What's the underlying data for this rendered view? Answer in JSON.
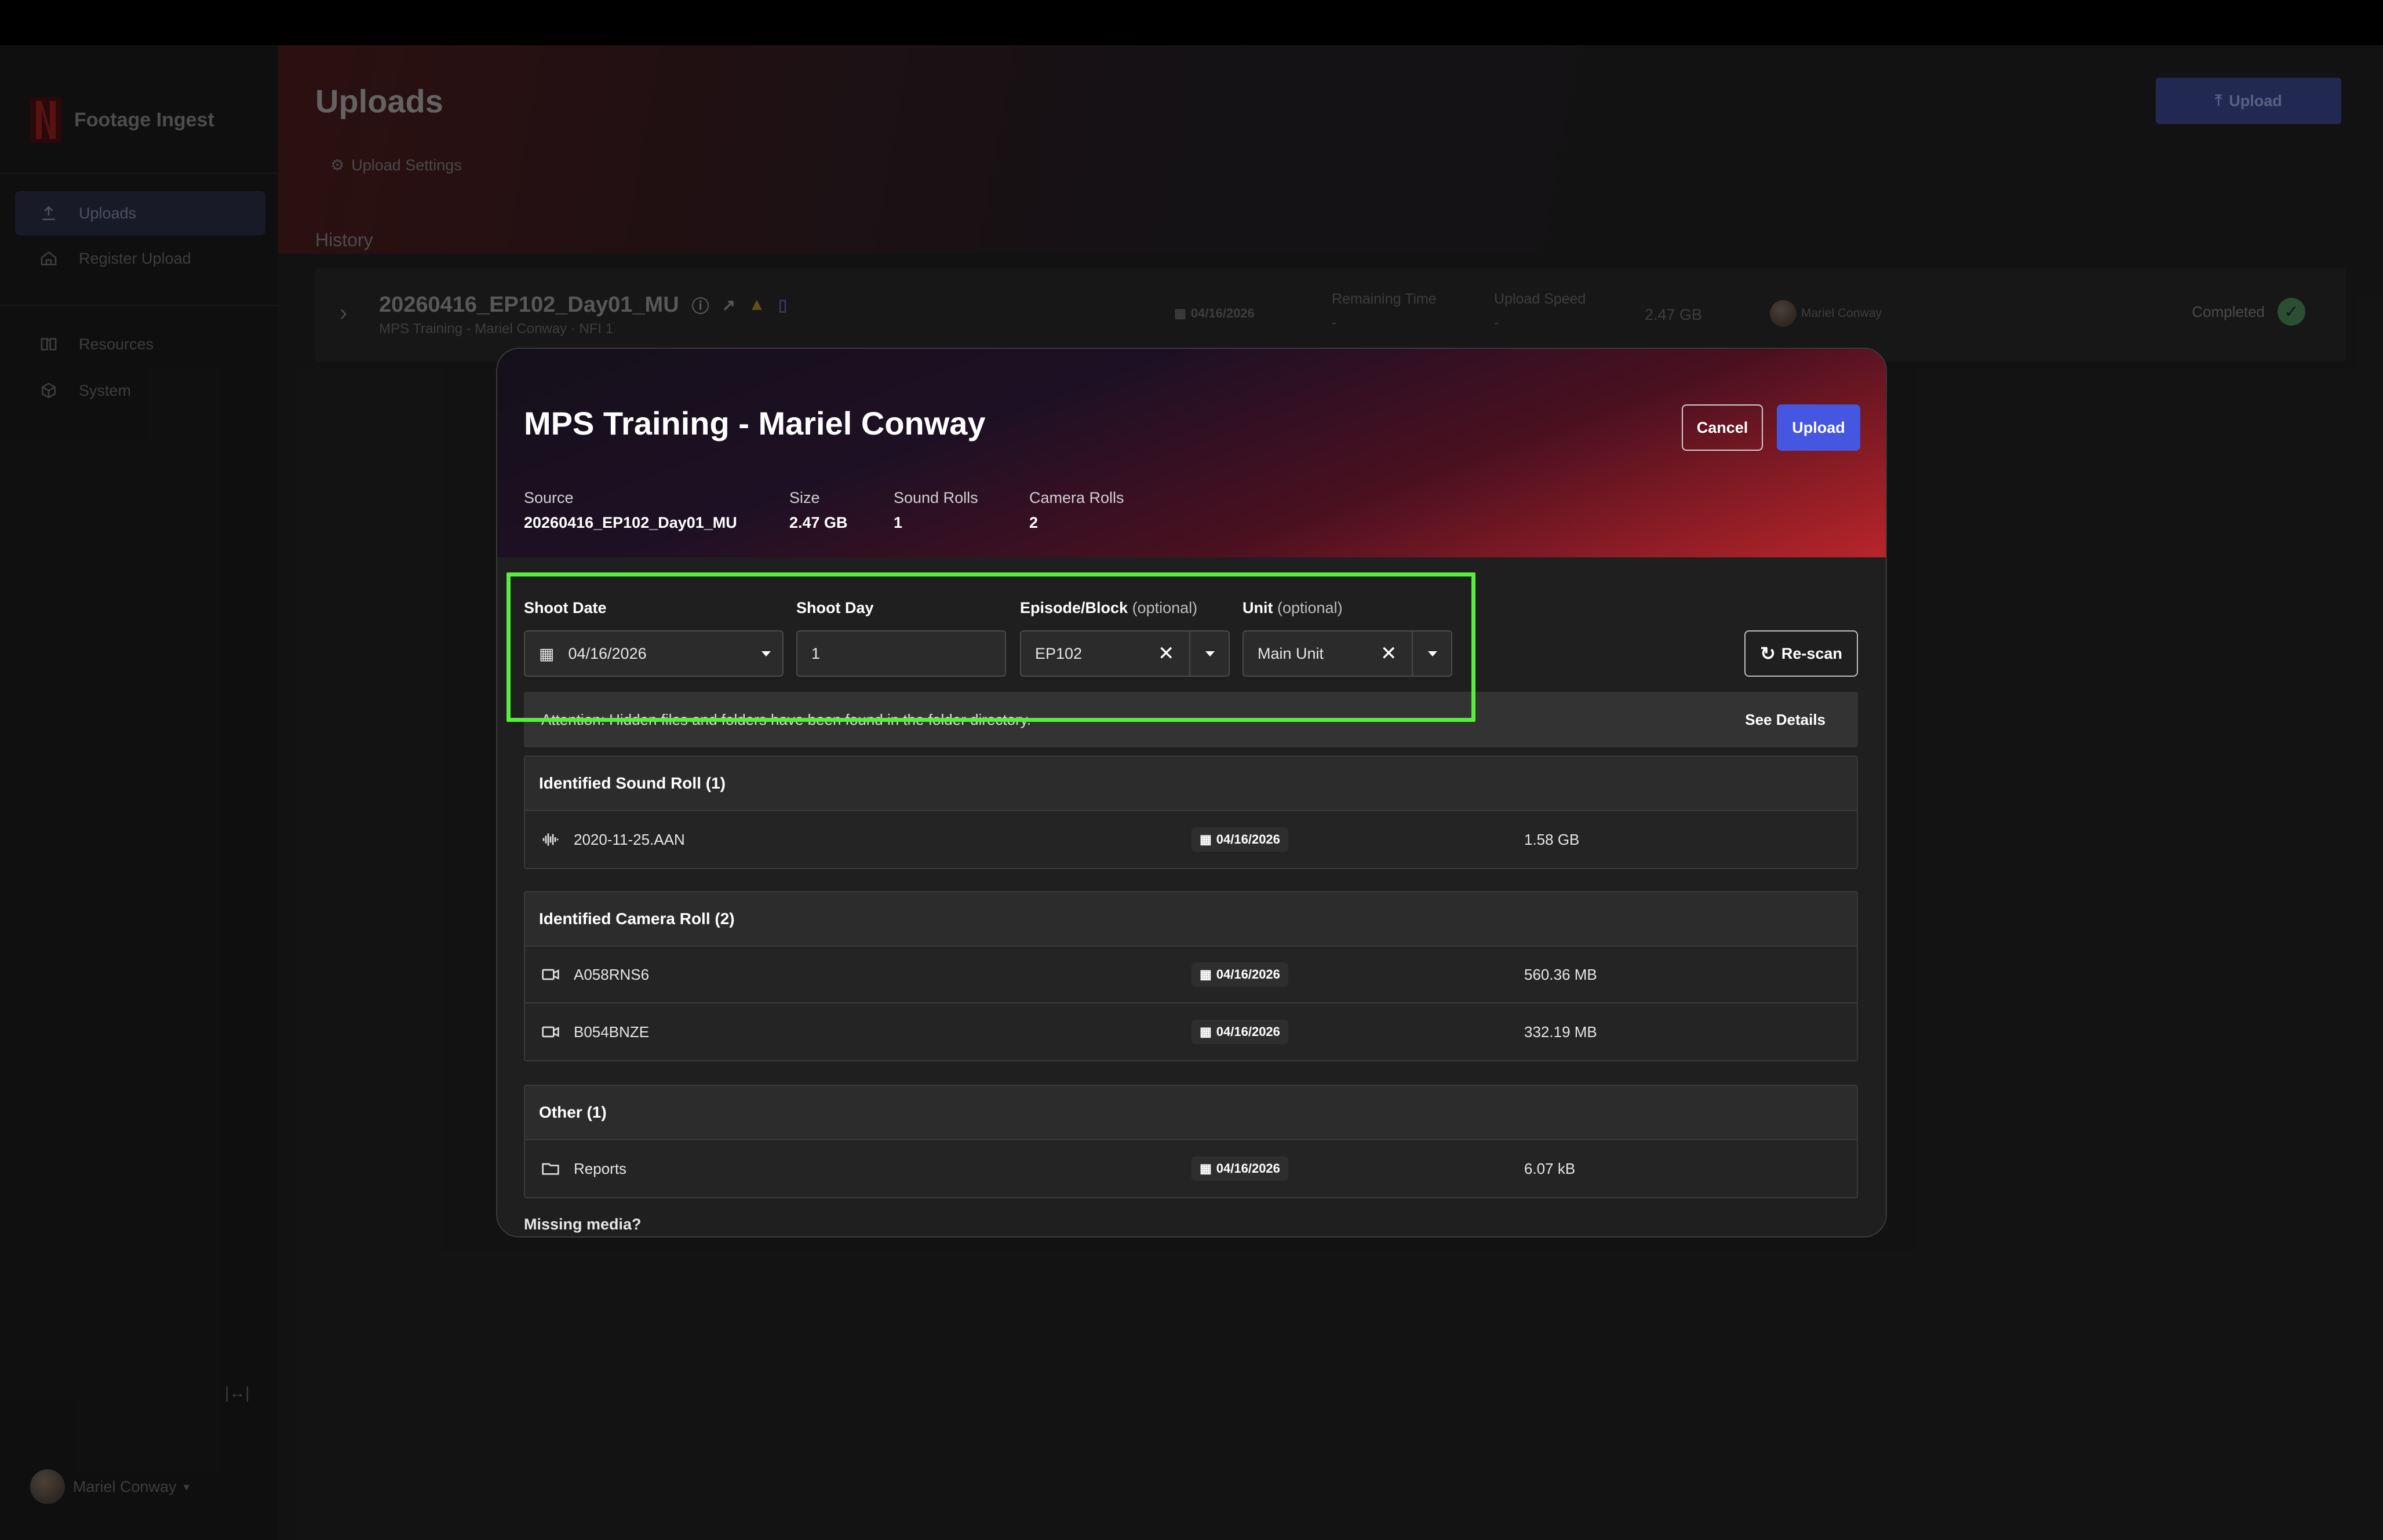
{
  "app": {
    "name": "Footage Ingest",
    "user_name": "Mariel Conway"
  },
  "sidebar": {
    "items": [
      {
        "label": "Uploads",
        "icon": "upload-icon",
        "active": true
      },
      {
        "label": "Register Upload",
        "icon": "home-icon",
        "active": false
      },
      {
        "label": "Resources",
        "icon": "book-icon",
        "active": false
      },
      {
        "label": "System",
        "icon": "cube-icon",
        "active": false
      }
    ]
  },
  "page": {
    "title": "Uploads",
    "upload_button": "Upload",
    "upload_settings": "Upload Settings",
    "history_label": "History"
  },
  "history": {
    "name": "20260416_EP102_Day01_MU",
    "subtitle": "MPS Training - Mariel Conway · NFI 1",
    "date": "04/16/2026",
    "remaining_time_label": "Remaining Time",
    "remaining_time_value": "-",
    "upload_speed_label": "Upload Speed",
    "upload_speed_value": "-",
    "size": "2.47 GB",
    "user": "Mariel Conway",
    "status": "Completed"
  },
  "modal": {
    "title": "MPS Training - Mariel Conway",
    "cancel": "Cancel",
    "upload": "Upload",
    "meta": {
      "source_label": "Source",
      "source_value": "20260416_EP102_Day01_MU",
      "size_label": "Size",
      "size_value": "2.47 GB",
      "sound_label": "Sound Rolls",
      "sound_value": "1",
      "camera_label": "Camera Rolls",
      "camera_value": "2"
    },
    "fields": {
      "shoot_date_label": "Shoot Date",
      "shoot_date_value": "04/16/2026",
      "shoot_day_label": "Shoot Day",
      "shoot_day_value": "1",
      "episode_label": "Episode/Block",
      "episode_opt": "(optional)",
      "episode_value": "EP102",
      "unit_label": "Unit",
      "unit_opt": "(optional)",
      "unit_value": "Main Unit"
    },
    "rescan": "Re-scan",
    "attention": "Attention: Hidden files and folders have been found in the folder directory.",
    "see_details": "See Details",
    "groups": [
      {
        "title": "Identified Sound Roll (1)",
        "items": [
          {
            "name": "2020-11-25.AAN",
            "icon": "audio-waveform-icon",
            "date": "04/16/2026",
            "size": "1.58 GB"
          }
        ]
      },
      {
        "title": "Identified Camera Roll (2)",
        "items": [
          {
            "name": "A058RNS6",
            "icon": "video-camera-icon",
            "date": "04/16/2026",
            "size": "560.36 MB"
          },
          {
            "name": "B054BNZE",
            "icon": "video-camera-icon",
            "date": "04/16/2026",
            "size": "332.19 MB"
          }
        ]
      },
      {
        "title": "Other (1)",
        "items": [
          {
            "name": "Reports",
            "icon": "folder-icon",
            "date": "04/16/2026",
            "size": "6.07 kB"
          }
        ]
      }
    ],
    "missing_media": "Missing media?"
  },
  "colors": {
    "accent": "#4556e0",
    "highlight": "#55ee3b",
    "completed": "#3d6e49"
  }
}
